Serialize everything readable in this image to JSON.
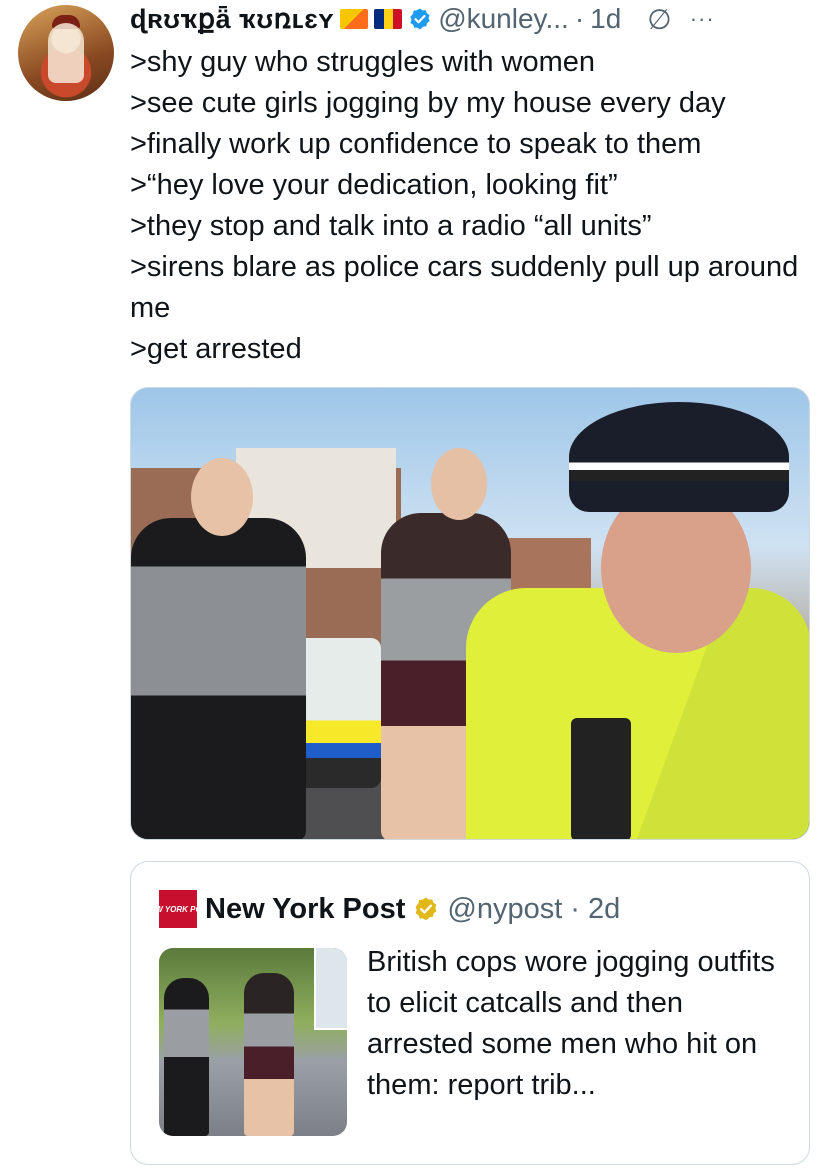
{
  "post": {
    "author_name": "ɖʀʊҡքǟ ҡʊռʟɛʏ",
    "flags": [
      "bhutan-flag",
      "romania-flag"
    ],
    "handle": "@kunley...",
    "separator": "·",
    "time": "1d",
    "no_edit_symbol": "∅",
    "more_symbol": "···",
    "lines": [
      ">shy guy who struggles with women",
      ">see cute girls jogging by my house every day",
      ">finally work up confidence to speak to them",
      ">“hey love your dedication, looking fit”",
      ">they stop and talk into a radio “all units”",
      ">sirens blare as police cars suddenly pull up around me",
      ">get arrested"
    ]
  },
  "quote": {
    "logo_text": "NEW YORK POST",
    "name": "New York Post",
    "handle": "@nypost",
    "separator": "·",
    "time": "2d",
    "text": "British cops wore jogging outfits to elicit catcalls and then arrested some men who hit on them: report trib..."
  },
  "colors": {
    "text": "#0f1419",
    "secondary": "#536471",
    "verified_blue": "#1d9bf0",
    "verified_gold": "#e2b719",
    "border": "#cfd9de",
    "nypost_red": "#c8102e"
  }
}
